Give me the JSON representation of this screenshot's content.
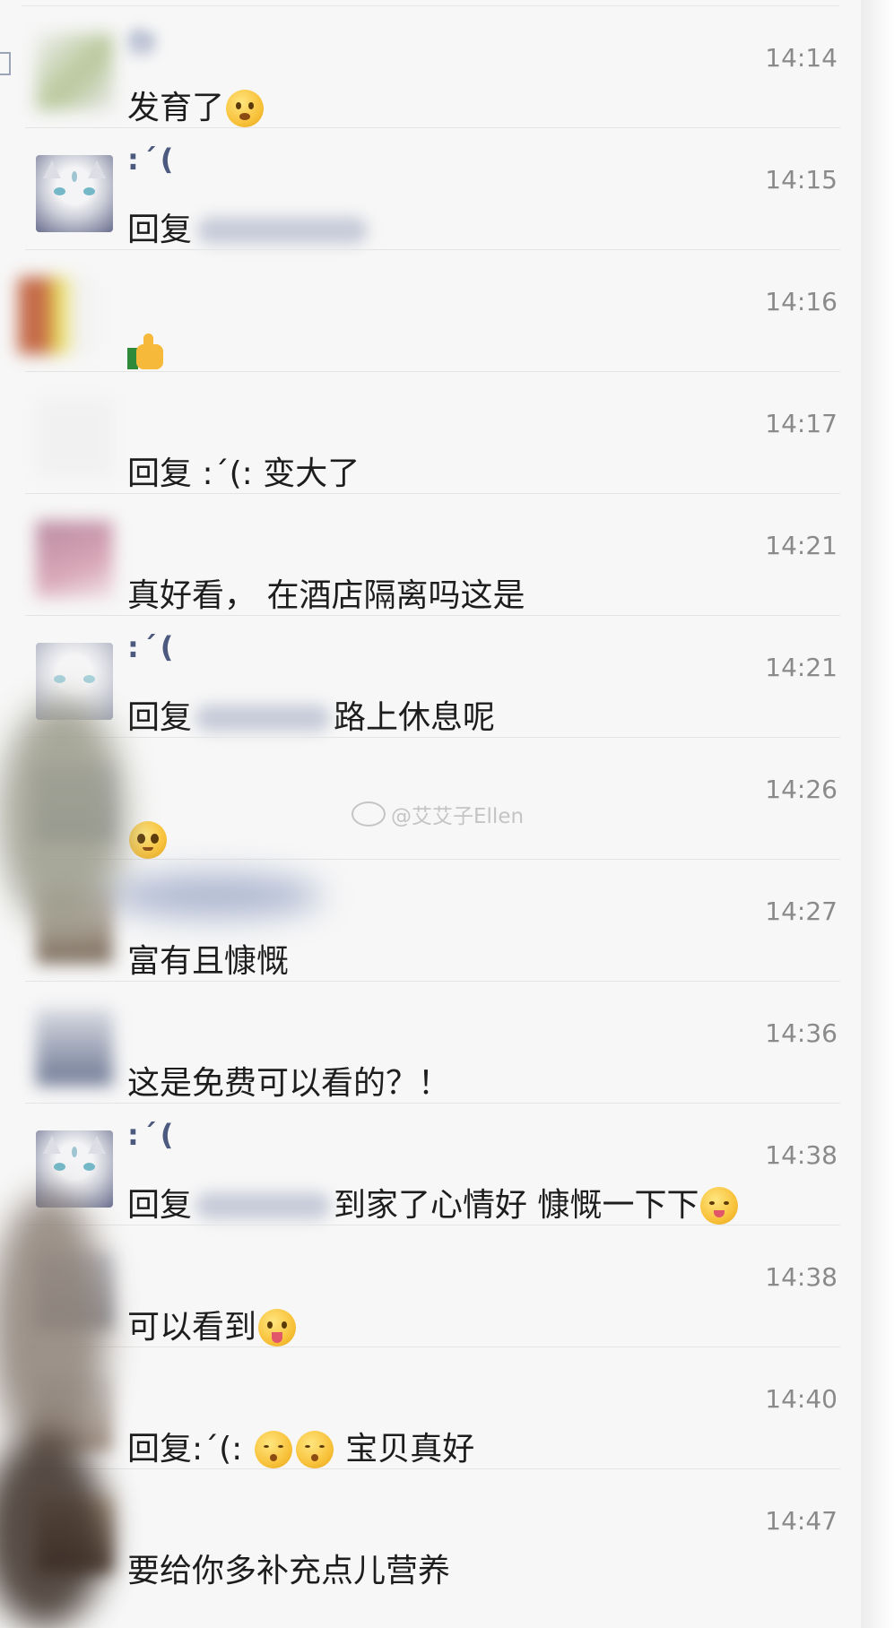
{
  "watermark": {
    "text": "@艾艾子Ellen"
  },
  "messages": [
    {
      "sender": "你",
      "time": "14:14",
      "text": "发育了",
      "emoji": "astonished-face-emoji"
    },
    {
      "sender": ":´(",
      "time": "14:15",
      "text": "回复",
      "emoji": ""
    },
    {
      "sender": "",
      "time": "14:16",
      "text": "",
      "emoji": "thumbs-up-emoji"
    },
    {
      "sender": "",
      "time": "14:17",
      "text": "回复 :´(: 变大了",
      "emoji": ""
    },
    {
      "sender": "",
      "time": "14:21",
      "text": "真好看， 在酒店隔离吗这是",
      "emoji": ""
    },
    {
      "sender": ":´(",
      "time": "14:21",
      "text_prefix": "回复",
      "text": "路上休息呢",
      "emoji": ""
    },
    {
      "sender": "",
      "time": "14:26",
      "text": "",
      "emoji": "pleading-face-emoji"
    },
    {
      "sender": "",
      "time": "14:27",
      "text": "富有且慷慨",
      "emoji": ""
    },
    {
      "sender": "",
      "time": "14:36",
      "text": "这是免费可以看的？！",
      "emoji": ""
    },
    {
      "sender": ":´(",
      "time": "14:38",
      "text_prefix": "回复",
      "text": "到家了心情好 慷慨一下下",
      "emoji": "yum-face-emoji"
    },
    {
      "sender": "",
      "time": "14:38",
      "text": "可以看到",
      "emoji": "tongue-out-face-emoji"
    },
    {
      "sender": "",
      "time": "14:40",
      "text_prefix": "回复:´(:",
      "text": "宝贝真好",
      "emoji": "kissing-face-emoji"
    },
    {
      "sender": "",
      "time": "14:47",
      "text": "要给你多补充点儿营养",
      "emoji": ""
    }
  ],
  "colors": {
    "background": "#f7f7f7",
    "name": "#4d5a7f",
    "time": "#8a8a8a",
    "text": "#1d1d1d",
    "separator": "#e4e4e4"
  }
}
